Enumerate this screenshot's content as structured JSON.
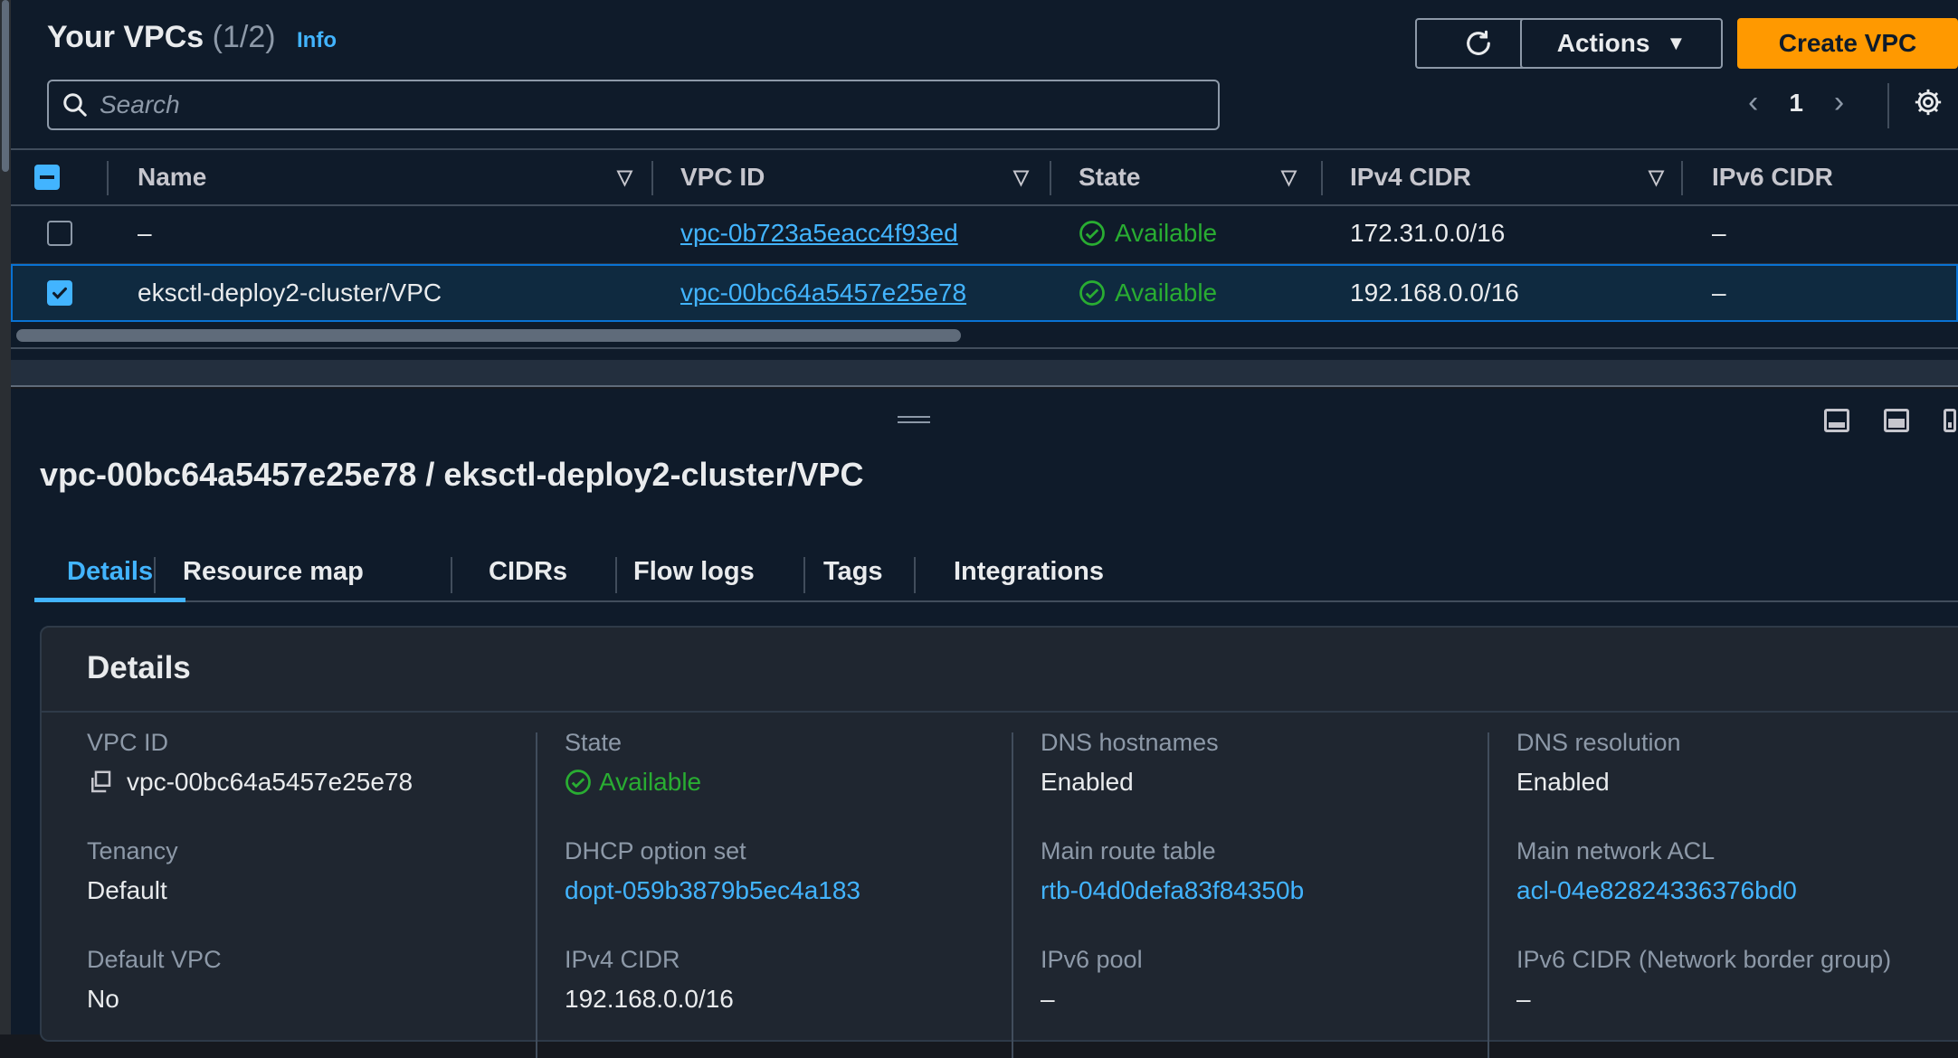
{
  "header": {
    "title": "Your VPCs",
    "count": "(1/2)",
    "info": "Info",
    "actions_label": "Actions",
    "create_label": "Create VPC"
  },
  "search": {
    "placeholder": "Search"
  },
  "pagination": {
    "page": "1"
  },
  "table": {
    "columns": [
      "Name",
      "VPC ID",
      "State",
      "IPv4 CIDR",
      "IPv6 CIDR"
    ],
    "rows": [
      {
        "name": "–",
        "vpc_id": "vpc-0b723a5eacc4f93ed",
        "state": "Available",
        "ipv4": "172.31.0.0/16",
        "ipv6": "–",
        "selected": false
      },
      {
        "name": "eksctl-deploy2-cluster/VPC",
        "vpc_id": "vpc-00bc64a5457e25e78",
        "state": "Available",
        "ipv4": "192.168.0.0/16",
        "ipv6": "–",
        "selected": true
      }
    ]
  },
  "detail": {
    "title": "vpc-00bc64a5457e25e78 / eksctl-deploy2-cluster/VPC",
    "tabs": [
      "Details",
      "Resource map",
      "CIDRs",
      "Flow logs",
      "Tags",
      "Integrations"
    ],
    "active_tab": "Details",
    "section_title": "Details",
    "fields": {
      "vpc_id": {
        "label": "VPC ID",
        "value": "vpc-00bc64a5457e25e78"
      },
      "state": {
        "label": "State",
        "value": "Available"
      },
      "dns_hostnames": {
        "label": "DNS hostnames",
        "value": "Enabled"
      },
      "dns_resolution": {
        "label": "DNS resolution",
        "value": "Enabled"
      },
      "tenancy": {
        "label": "Tenancy",
        "value": "Default"
      },
      "dhcp": {
        "label": "DHCP option set",
        "value": "dopt-059b3879b5ec4a183"
      },
      "route_table": {
        "label": "Main route table",
        "value": "rtb-04d0defa83f84350b"
      },
      "network_acl": {
        "label": "Main network ACL",
        "value": "acl-04e82824336376bd0"
      },
      "default_vpc": {
        "label": "Default VPC",
        "value": "No"
      },
      "ipv4_cidr": {
        "label": "IPv4 CIDR",
        "value": "192.168.0.0/16"
      },
      "ipv6_pool": {
        "label": "IPv6 pool",
        "value": "–"
      },
      "ipv6_cidr": {
        "label": "IPv6 CIDR (Network border group)",
        "value": "–"
      }
    }
  },
  "colors": {
    "accent": "#ff9900",
    "link": "#42b4ff",
    "success": "#29ad32",
    "background": "#0f1b2a"
  },
  "icons": [
    "refresh-icon",
    "caret-down-icon",
    "search-icon",
    "chevron-left-icon",
    "chevron-right-icon",
    "gear-icon",
    "sort-icon",
    "check-circle-icon",
    "copy-icon"
  ]
}
